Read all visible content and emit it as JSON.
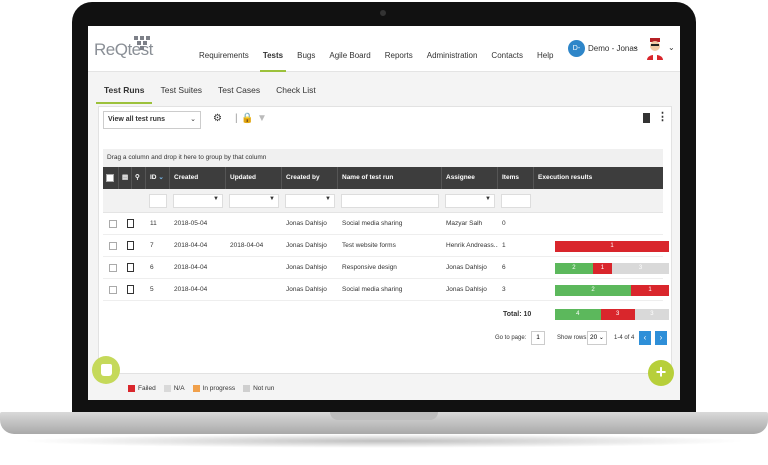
{
  "app": {
    "logo_text": "ReQtest"
  },
  "nav": {
    "items": [
      "Requirements",
      "Tests",
      "Bugs",
      "Agile Board",
      "Reports",
      "Administration",
      "Contacts",
      "Help"
    ],
    "active": "Tests"
  },
  "user": {
    "initials": "D-",
    "name": "Demo - Jonas"
  },
  "tabs": {
    "items": [
      "Test Runs",
      "Test Suites",
      "Test Cases",
      "Check List"
    ],
    "active": "Test Runs"
  },
  "toolbar": {
    "view_select": "View all test runs"
  },
  "grid": {
    "group_hint": "Drag a column and drop it here to group by that column",
    "headers": {
      "id": "ID",
      "created": "Created",
      "updated": "Updated",
      "created_by": "Created by",
      "name": "Name of test run",
      "assignee": "Assignee",
      "items": "Items",
      "results": "Execution results"
    },
    "rows": [
      {
        "id": "11",
        "created": "2018-05-04",
        "updated": "",
        "created_by": "Jonas Dahlsjo",
        "name": "Social media sharing",
        "assignee": "Mazyar Salh",
        "items": "0",
        "bar": []
      },
      {
        "id": "7",
        "created": "2018-04-04",
        "updated": "2018-04-04",
        "created_by": "Jonas Dahlsjo",
        "name": "Test website forms",
        "assignee": "Henrik Andreass...",
        "items": "1",
        "bar": [
          {
            "type": "fail",
            "value": "1",
            "fraction": 1.0
          }
        ]
      },
      {
        "id": "6",
        "created": "2018-04-04",
        "updated": "",
        "created_by": "Jonas Dahlsjo",
        "name": "Responsive design",
        "assignee": "Jonas Dahlsjo",
        "items": "6",
        "bar": [
          {
            "type": "pass",
            "value": "2",
            "fraction": 0.333
          },
          {
            "type": "fail",
            "value": "1",
            "fraction": 0.167
          },
          {
            "type": "na",
            "value": "3",
            "fraction": 0.5
          }
        ]
      },
      {
        "id": "5",
        "created": "2018-04-04",
        "updated": "",
        "created_by": "Jonas Dahlsjo",
        "name": "Social media sharing",
        "assignee": "Jonas Dahlsjo",
        "items": "3",
        "bar": [
          {
            "type": "pass",
            "value": "2",
            "fraction": 0.667
          },
          {
            "type": "fail",
            "value": "1",
            "fraction": 0.333
          }
        ]
      }
    ],
    "total_label": "Total: 10",
    "total_bar": [
      {
        "type": "pass",
        "value": "4",
        "fraction": 0.4
      },
      {
        "type": "fail",
        "value": "3",
        "fraction": 0.3
      },
      {
        "type": "na",
        "value": "3",
        "fraction": 0.3
      }
    ]
  },
  "pager": {
    "goto_label": "Go to page:",
    "page": "1",
    "show_label": "Show rows:",
    "rows": "20",
    "range": "1-4 of 4"
  },
  "legend": [
    {
      "label": "Failed",
      "color": "#d9262c"
    },
    {
      "label": "N/A",
      "color": "#d9d9d9"
    },
    {
      "label": "In progress",
      "color": "#f0a04b"
    },
    {
      "label": "Not run",
      "color": "#cfcfcf"
    }
  ],
  "colors": {
    "accent": "#9cc13b",
    "pass": "#5cb85c",
    "fail": "#d9262c",
    "na": "#d9d9d9",
    "header": "#3d3d3d",
    "link": "#2e8fd8"
  }
}
